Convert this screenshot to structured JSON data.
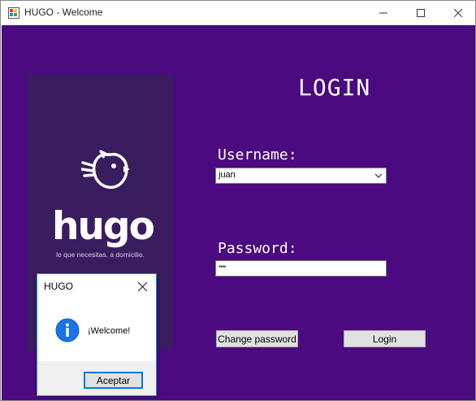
{
  "window": {
    "title": "HUGO - Welcome",
    "icons": {
      "app": "app-icon",
      "minimize": "minimize-icon",
      "maximize": "maximize-icon",
      "close": "close-icon"
    }
  },
  "colors": {
    "background": "#4b0a7f",
    "logo_panel": "#3a1d5e",
    "accent_border": "#1e90ff",
    "info_icon": "#1a73e8"
  },
  "logo": {
    "wordmark": "hugo",
    "tagline": "lo que necesitas. a domicilio.",
    "icon": "bird-icon"
  },
  "login": {
    "title": "LOGIN",
    "username_label": "Username:",
    "username_value": "juan",
    "password_label": "Password:",
    "password_value": "****",
    "change_password_button": "Change password",
    "login_button": "Login"
  },
  "message_box": {
    "title": "HUGO",
    "message": "¡Welcome!",
    "ok_button": "Aceptar",
    "icon": "info-icon"
  }
}
